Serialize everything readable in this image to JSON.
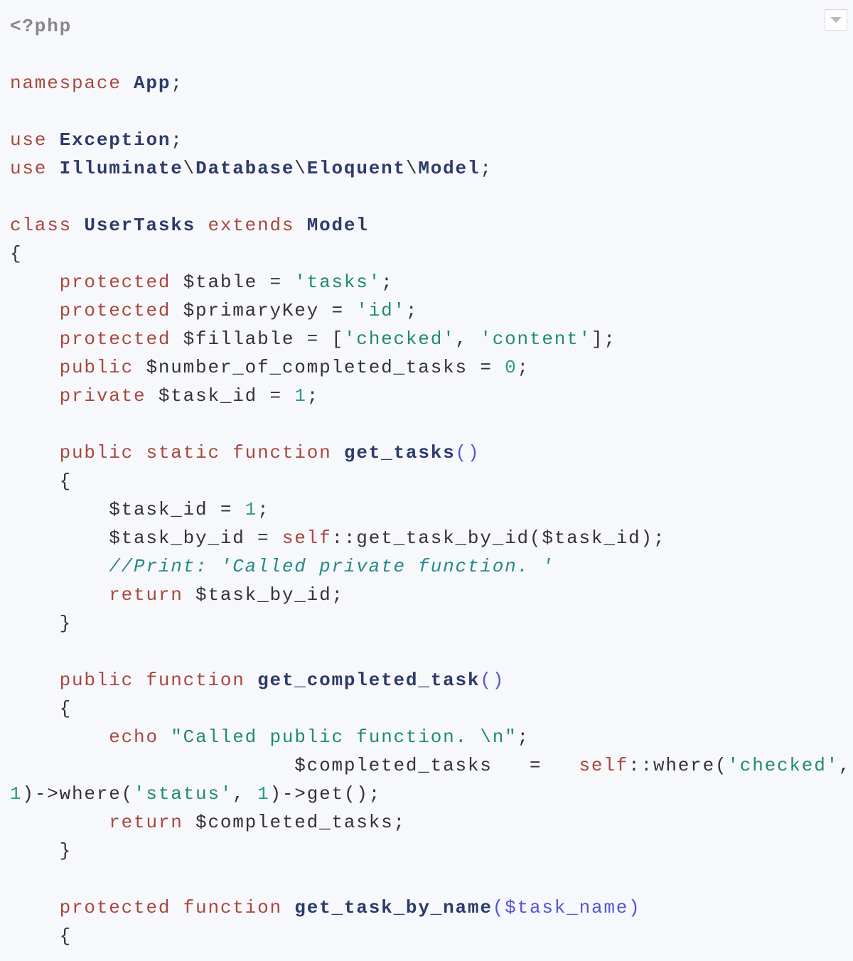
{
  "language": "php",
  "code_lines": [
    [
      {
        "t": "<?php",
        "c": "tag"
      }
    ],
    [],
    [
      {
        "t": "namespace",
        "c": "kw"
      },
      {
        "t": " "
      },
      {
        "t": "App",
        "c": "cls"
      },
      {
        "t": ";"
      }
    ],
    [],
    [
      {
        "t": "use",
        "c": "kw"
      },
      {
        "t": " "
      },
      {
        "t": "Exception",
        "c": "cls"
      },
      {
        "t": ";"
      }
    ],
    [
      {
        "t": "use",
        "c": "kw"
      },
      {
        "t": " "
      },
      {
        "t": "Illuminate",
        "c": "cls"
      },
      {
        "t": "\\"
      },
      {
        "t": "Database",
        "c": "cls"
      },
      {
        "t": "\\"
      },
      {
        "t": "Eloquent",
        "c": "cls"
      },
      {
        "t": "\\"
      },
      {
        "t": "Model",
        "c": "cls"
      },
      {
        "t": ";"
      }
    ],
    [],
    [
      {
        "t": "class",
        "c": "kw"
      },
      {
        "t": " "
      },
      {
        "t": "UserTasks",
        "c": "cls"
      },
      {
        "t": " "
      },
      {
        "t": "extends",
        "c": "kw"
      },
      {
        "t": " "
      },
      {
        "t": "Model",
        "c": "cls"
      }
    ],
    [
      {
        "t": "{"
      }
    ],
    [
      {
        "t": "    "
      },
      {
        "t": "protected",
        "c": "kw"
      },
      {
        "t": " $table = "
      },
      {
        "t": "'tasks'",
        "c": "str"
      },
      {
        "t": ";"
      }
    ],
    [
      {
        "t": "    "
      },
      {
        "t": "protected",
        "c": "kw"
      },
      {
        "t": " $primaryKey = "
      },
      {
        "t": "'id'",
        "c": "str"
      },
      {
        "t": ";"
      }
    ],
    [
      {
        "t": "    "
      },
      {
        "t": "protected",
        "c": "kw"
      },
      {
        "t": " $fillable = ["
      },
      {
        "t": "'checked'",
        "c": "str"
      },
      {
        "t": ", "
      },
      {
        "t": "'content'",
        "c": "str"
      },
      {
        "t": "];"
      }
    ],
    [
      {
        "t": "    "
      },
      {
        "t": "public",
        "c": "kw"
      },
      {
        "t": " $number_of_completed_tasks = "
      },
      {
        "t": "0",
        "c": "num"
      },
      {
        "t": ";"
      }
    ],
    [
      {
        "t": "    "
      },
      {
        "t": "private",
        "c": "kw"
      },
      {
        "t": " $task_id = "
      },
      {
        "t": "1",
        "c": "num"
      },
      {
        "t": ";"
      }
    ],
    [],
    [
      {
        "t": "    "
      },
      {
        "t": "public",
        "c": "kw"
      },
      {
        "t": " "
      },
      {
        "t": "static",
        "c": "kw"
      },
      {
        "t": " "
      },
      {
        "t": "function",
        "c": "kw"
      },
      {
        "t": " "
      },
      {
        "t": "get_tasks",
        "c": "cls"
      },
      {
        "t": "()",
        "c": "par"
      }
    ],
    [
      {
        "t": "    {"
      }
    ],
    [
      {
        "t": "        $task_id = "
      },
      {
        "t": "1",
        "c": "num"
      },
      {
        "t": ";"
      }
    ],
    [
      {
        "t": "        $task_by_id = "
      },
      {
        "t": "self",
        "c": "kw"
      },
      {
        "t": "::get_task_by_id($task_id);"
      }
    ],
    [
      {
        "t": "        "
      },
      {
        "t": "//Print: 'Called private function. '",
        "c": "cmt"
      }
    ],
    [
      {
        "t": "        "
      },
      {
        "t": "return",
        "c": "kw"
      },
      {
        "t": " $task_by_id;"
      }
    ],
    [
      {
        "t": "    }"
      }
    ],
    [],
    [
      {
        "t": "    "
      },
      {
        "t": "public",
        "c": "kw"
      },
      {
        "t": " "
      },
      {
        "t": "function",
        "c": "kw"
      },
      {
        "t": " "
      },
      {
        "t": "get_completed_task",
        "c": "cls"
      },
      {
        "t": "()",
        "c": "par"
      }
    ],
    [
      {
        "t": "    {"
      }
    ],
    [
      {
        "t": "        "
      },
      {
        "t": "echo",
        "c": "kw"
      },
      {
        "t": " "
      },
      {
        "t": "\"Called public function. \\n\"",
        "c": "str"
      },
      {
        "t": ";"
      }
    ],
    [
      {
        "t": "                       $completed_tasks   =   "
      },
      {
        "t": "self",
        "c": "kw"
      },
      {
        "t": "::where("
      },
      {
        "t": "'checked'",
        "c": "str"
      },
      {
        "t": ","
      }
    ],
    [
      {
        "t": "1",
        "c": "num"
      },
      {
        "t": ")->where("
      },
      {
        "t": "'status'",
        "c": "str"
      },
      {
        "t": ", "
      },
      {
        "t": "1",
        "c": "num"
      },
      {
        "t": ")->get();"
      }
    ],
    [
      {
        "t": "        "
      },
      {
        "t": "return",
        "c": "kw"
      },
      {
        "t": " $completed_tasks;"
      }
    ],
    [
      {
        "t": "    }"
      }
    ],
    [],
    [
      {
        "t": "    "
      },
      {
        "t": "protected",
        "c": "kw"
      },
      {
        "t": " "
      },
      {
        "t": "function",
        "c": "kw"
      },
      {
        "t": " "
      },
      {
        "t": "get_task_by_name",
        "c": "cls"
      },
      {
        "t": "($task_name)",
        "c": "par"
      }
    ],
    [
      {
        "t": "    {"
      }
    ]
  ],
  "dropdown_icon": "chevron-down-icon"
}
